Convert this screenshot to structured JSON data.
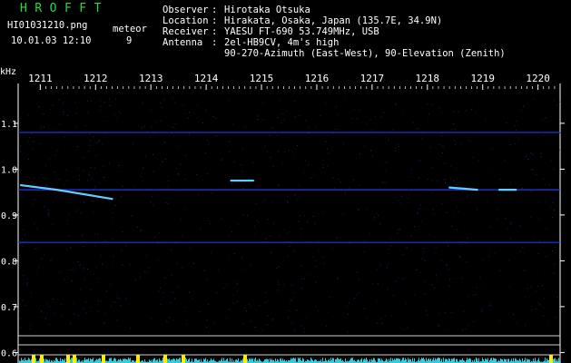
{
  "header": {
    "app_title": "HROFFT",
    "filename": "HI01031210.png",
    "datetime": "10.01.03 12:10",
    "meteor_label": "meteor",
    "meteor_count": "9"
  },
  "station": [
    {
      "label": "Observer",
      "value": "Hirotaka Otsuka"
    },
    {
      "label": "Location",
      "value": "Hirakata, Osaka, Japan (135.7E, 34.9N)"
    },
    {
      "label": "Receiver",
      "value": "YAESU FT-690 53.749MHz, USB"
    },
    {
      "label": "Antenna",
      "value": "2el-HB9CV, 4m's high"
    },
    {
      "label": "",
      "value": "90-270-Azimuth (East-West), 90-Elevation (Zenith)"
    }
  ],
  "colors": {
    "title": "#22dd44",
    "trace": "#2244ff",
    "echo": "#66ccff",
    "strip": "#33ccdd",
    "strip_hot": "#ffee00"
  },
  "chart_data": {
    "type": "heatmap",
    "y_unit_label": "kHz",
    "x_ticks": [
      "1211",
      "1212",
      "1213",
      "1214",
      "1215",
      "1216",
      "1217",
      "1218",
      "1219",
      "1220"
    ],
    "y_ticks": [
      "1.1",
      "1.0",
      "0.9",
      "0.8",
      "0.7",
      "0.6"
    ],
    "ylim": [
      0.585,
      1.175
    ],
    "xlim": [
      1210.6,
      1220.4
    ],
    "horizontal_lines_khz": [
      1.08,
      0.955,
      0.84
    ],
    "echoes": [
      {
        "start_time": 1210.65,
        "end_time": 1211.3,
        "start_khz": 0.965,
        "end_khz": 0.955
      },
      {
        "start_time": 1211.3,
        "end_time": 1212.3,
        "start_khz": 0.955,
        "end_khz": 0.935
      },
      {
        "start_time": 1214.45,
        "end_time": 1214.85,
        "start_khz": 0.975,
        "end_khz": 0.975
      },
      {
        "start_time": 1218.4,
        "end_time": 1218.9,
        "start_khz": 0.96,
        "end_khz": 0.955
      },
      {
        "start_time": 1219.3,
        "end_time": 1219.6,
        "start_khz": 0.955,
        "end_khz": 0.955
      }
    ],
    "grid": false
  }
}
